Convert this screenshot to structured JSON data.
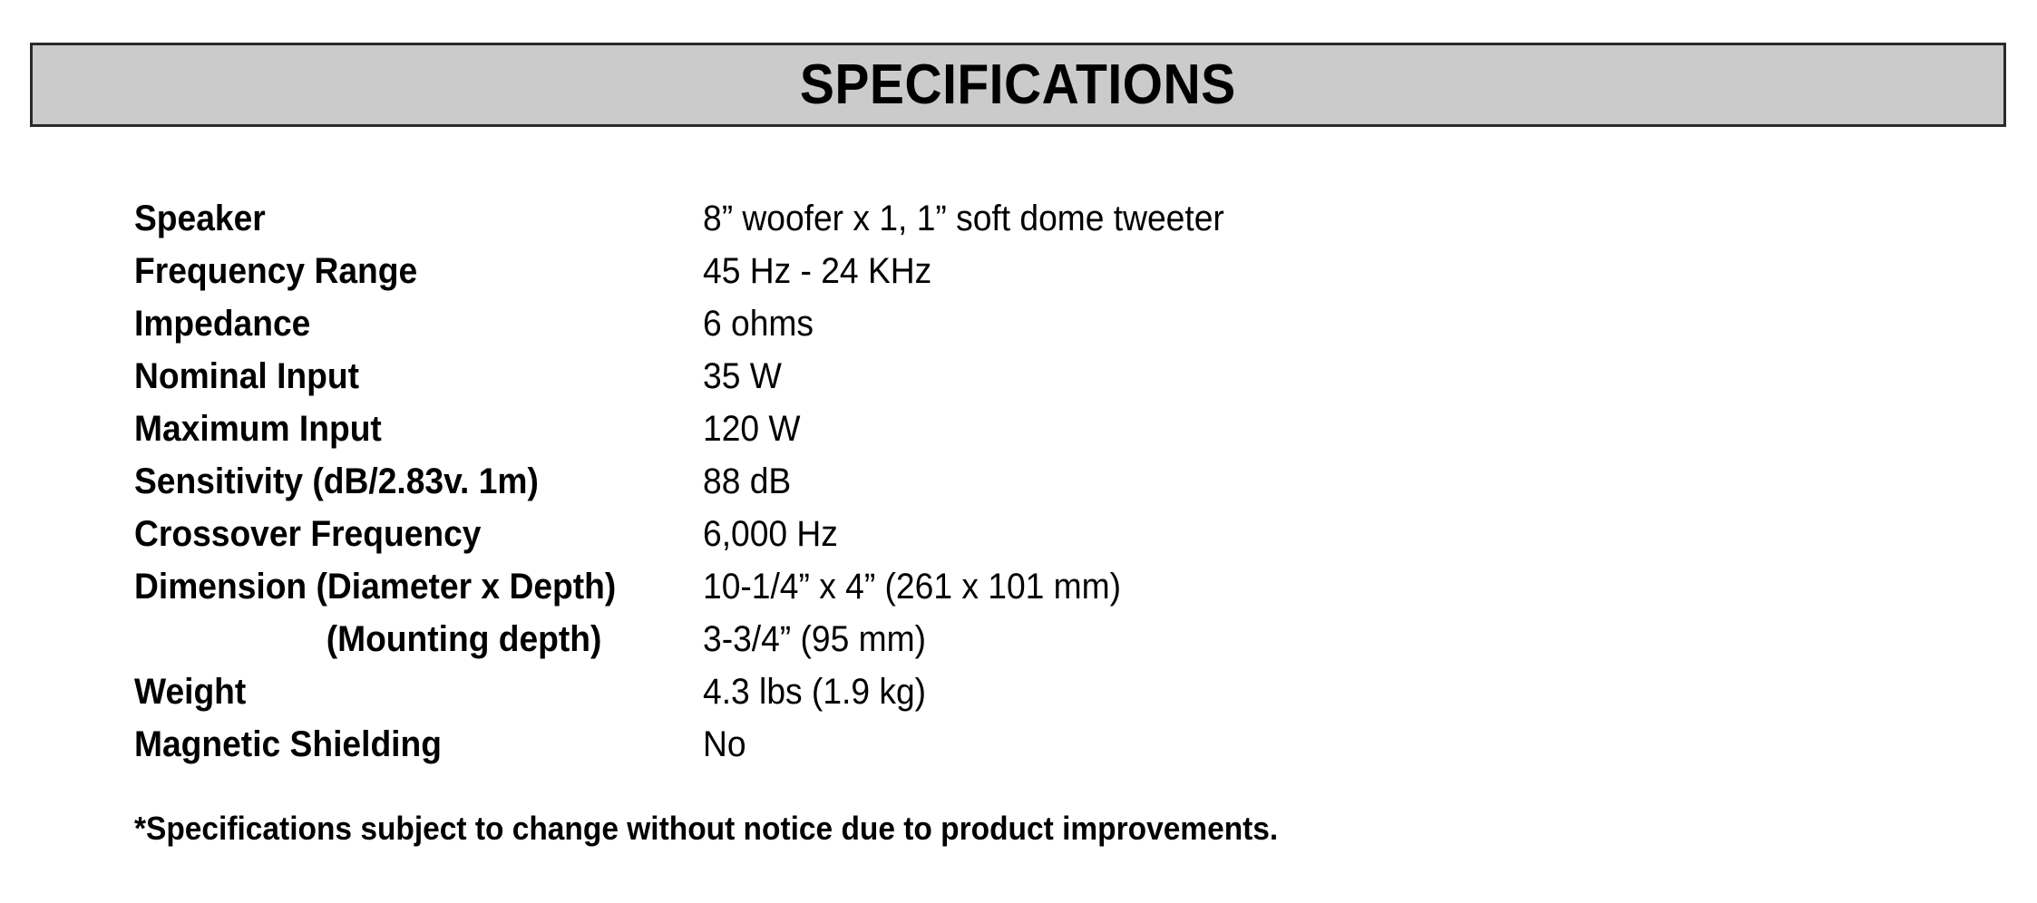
{
  "document": {
    "title": "SPECIFICATIONS",
    "header_background": "#cbcbcb",
    "header_border_color": "#2a2a2a",
    "page_background": "#ffffff",
    "text_color": "#000000"
  },
  "spec_table": {
    "rows": [
      {
        "label": "Speaker",
        "value": "8” woofer x 1, 1” soft dome tweeter",
        "indented": false
      },
      {
        "label": "Frequency Range",
        "value": "45 Hz - 24 KHz",
        "indented": false
      },
      {
        "label": "Impedance",
        "value": "6 ohms",
        "indented": false
      },
      {
        "label": "Nominal Input",
        "value": "35 W",
        "indented": false
      },
      {
        "label": "Maximum Input",
        "value": "120 W",
        "indented": false
      },
      {
        "label": "Sensitivity (dB/2.83v. 1m)",
        "value": "88 dB",
        "indented": false
      },
      {
        "label": "Crossover Frequency",
        "value": "6,000 Hz",
        "indented": false
      },
      {
        "label": "Dimension (Diameter x Depth)",
        "value": "10-1/4” x 4” (261 x 101 mm)",
        "indented": false
      },
      {
        "label": "(Mounting depth)",
        "value": "3-3/4” (95 mm)",
        "indented": true
      },
      {
        "label": "Weight",
        "value": "4.3 lbs (1.9 kg)",
        "indented": false
      },
      {
        "label": "Magnetic Shielding",
        "value": "No",
        "indented": false
      }
    ]
  },
  "footnote": {
    "text": "*Specifications subject to change without notice due to product improvements."
  }
}
